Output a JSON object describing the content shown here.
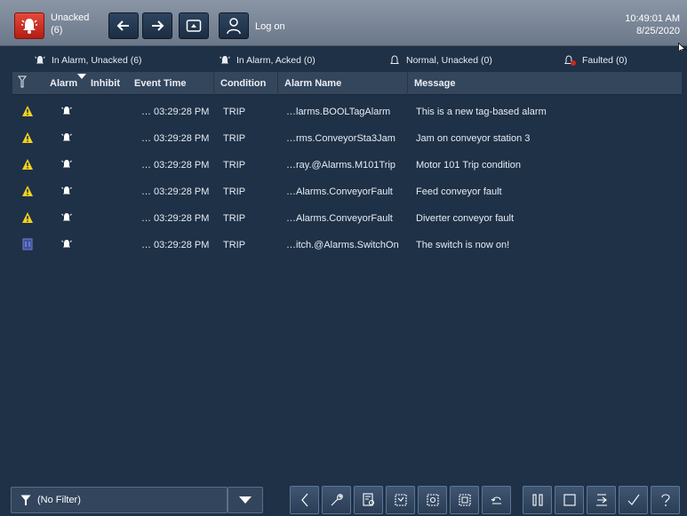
{
  "topbar": {
    "alarm_status_label": "Unacked",
    "alarm_status_count": "(6)",
    "logon_label": "Log on",
    "time": "10:49:01 AM",
    "date": "8/25/2020"
  },
  "summary": {
    "in_alarm_unacked": "In Alarm, Unacked (6)",
    "in_alarm_acked": "In Alarm, Acked (0)",
    "normal_unacked": "Normal, Unacked (0)",
    "faulted": "Faulted (0)"
  },
  "columns": {
    "alarm": "Alarm",
    "inhibit": "Inhibit",
    "event_time": "Event Time",
    "condition": "Condition",
    "alarm_name": "Alarm Name",
    "message": "Message"
  },
  "rows": [
    {
      "severity_icon": "warning-triangle-icon",
      "event_time": "… 03:29:28 PM",
      "condition": "TRIP",
      "alarm_name": "…larms.BOOLTagAlarm",
      "message": "This is a new tag-based alarm"
    },
    {
      "severity_icon": "warning-triangle-icon",
      "event_time": "… 03:29:28 PM",
      "condition": "TRIP",
      "alarm_name": "…rms.ConveyorSta3Jam",
      "message": "Jam on conveyor station 3"
    },
    {
      "severity_icon": "warning-triangle-icon",
      "event_time": "… 03:29:28 PM",
      "condition": "TRIP",
      "alarm_name": "…ray.@Alarms.M101Trip",
      "message": "Motor 101 Trip condition"
    },
    {
      "severity_icon": "warning-triangle-icon",
      "event_time": "… 03:29:28 PM",
      "condition": "TRIP",
      "alarm_name": "…Alarms.ConveyorFault",
      "message": "Feed conveyor fault"
    },
    {
      "severity_icon": "warning-triangle-icon",
      "event_time": "… 03:29:28 PM",
      "condition": "TRIP",
      "alarm_name": "…Alarms.ConveyorFault",
      "message": "Diverter conveyor fault"
    },
    {
      "severity_icon": "info-severity-icon",
      "event_time": "… 03:29:28 PM",
      "condition": "TRIP",
      "alarm_name": "…itch.@Alarms.SwitchOn",
      "message": "The switch is now on!"
    }
  ],
  "footer": {
    "filter_value": "(No Filter)"
  },
  "colors": {
    "background": "#1f3147",
    "warning": "#f2d21b",
    "alarm_red": "#d0281d"
  }
}
